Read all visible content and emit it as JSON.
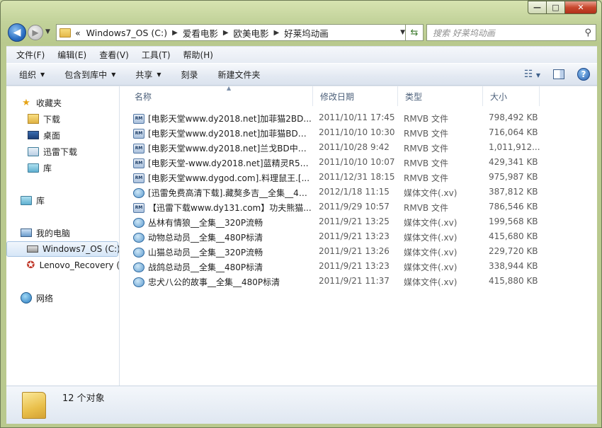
{
  "window": {
    "controls": {
      "minimize": "—",
      "maximize": "□",
      "close": "✕"
    }
  },
  "nav": {
    "back_glyph": "◀",
    "forward_glyph": "▶",
    "address": {
      "prefix": "«",
      "crumbs": [
        "Windows7_OS (C:)",
        "爱看电影",
        "欧美电影",
        "好莱坞动画"
      ]
    },
    "search_placeholder": "搜索 好莱坞动画"
  },
  "menu": [
    "文件(F)",
    "编辑(E)",
    "查看(V)",
    "工具(T)",
    "帮助(H)"
  ],
  "commands": {
    "organize": "组织",
    "include_library": "包含到库中",
    "share": "共享",
    "burn": "刻录",
    "new_folder": "新建文件夹"
  },
  "sidebar": {
    "favorites": "收藏夹",
    "downloads": "下载",
    "desktop": "桌面",
    "thunder": "迅雷下载",
    "library_fav": "库",
    "library": "库",
    "computer": "我的电脑",
    "drive_c": "Windows7_OS (C:)",
    "recovery": "Lenovo_Recovery (",
    "network": "网络"
  },
  "columns": {
    "name": "名称",
    "date": "修改日期",
    "type": "类型",
    "size": "大小"
  },
  "files": [
    {
      "name": "[电影天堂www.dy2018.net]加菲猫2BD...",
      "date": "2011/10/11 17:45",
      "type": "RMVB 文件",
      "size": "798,492 KB",
      "icon": "rmvb"
    },
    {
      "name": "[电影天堂www.dy2018.net]加菲猫BD中...",
      "date": "2011/10/10 10:30",
      "type": "RMVB 文件",
      "size": "716,064 KB",
      "icon": "rmvb"
    },
    {
      "name": "[电影天堂www.dy2018.net]兰戈BD中英...",
      "date": "2011/10/28 9:42",
      "type": "RMVB 文件",
      "size": "1,011,912...",
      "icon": "rmvb"
    },
    {
      "name": "[电影天堂-www.dy2018.net]蓝精灵R5中...",
      "date": "2011/10/10 10:07",
      "type": "RMVB 文件",
      "size": "429,341 KB",
      "icon": "rmvb"
    },
    {
      "name": "[电影天堂www.dygod.com].料理鼠王.[...",
      "date": "2011/12/31 18:15",
      "type": "RMVB 文件",
      "size": "975,987 KB",
      "icon": "rmvb"
    },
    {
      "name": "[迅雷免费高清下载].藏獒多吉__全集__48...",
      "date": "2012/1/18 11:15",
      "type": "媒体文件(.xv)",
      "size": "387,812 KB",
      "icon": "xv"
    },
    {
      "name": "【迅雷下载www.dy131.com】功夫熊猫...",
      "date": "2011/9/29 10:57",
      "type": "RMVB 文件",
      "size": "786,546 KB",
      "icon": "rmvb"
    },
    {
      "name": "丛林有情狼__全集__320P流畅",
      "date": "2011/9/21 13:25",
      "type": "媒体文件(.xv)",
      "size": "199,568 KB",
      "icon": "xv"
    },
    {
      "name": "动物总动员__全集__480P标清",
      "date": "2011/9/21 13:23",
      "type": "媒体文件(.xv)",
      "size": "415,680 KB",
      "icon": "xv"
    },
    {
      "name": "山猫总动员__全集__320P流畅",
      "date": "2011/9/21 13:26",
      "type": "媒体文件(.xv)",
      "size": "229,720 KB",
      "icon": "xv"
    },
    {
      "name": "战鸽总动员__全集__480P标清",
      "date": "2011/9/21 13:23",
      "type": "媒体文件(.xv)",
      "size": "338,944 KB",
      "icon": "xv"
    },
    {
      "name": "忠犬八公的故事__全集__480P标清",
      "date": "2011/9/21 11:37",
      "type": "媒体文件(.xv)",
      "size": "415,880 KB",
      "icon": "xv"
    }
  ],
  "status": {
    "count": "12 个对象"
  },
  "colors": {
    "accent": "#2b6fc3",
    "frame": "#c2d29a",
    "selection": "#d6e6f7"
  }
}
